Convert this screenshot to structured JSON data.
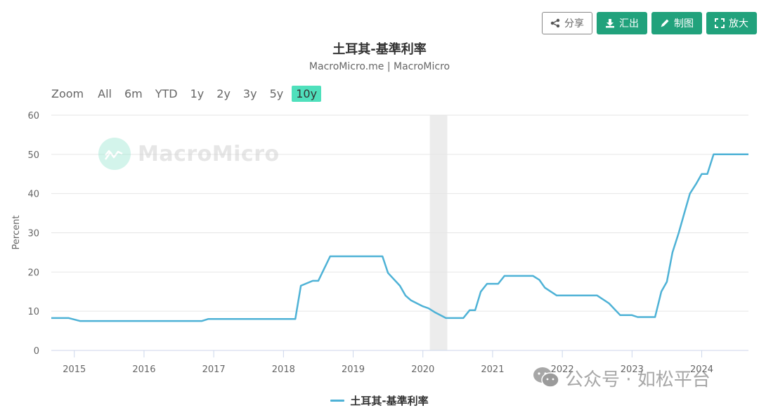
{
  "toolbar": {
    "share_label": "分享",
    "export_label": "汇出",
    "draw_label": "制图",
    "expand_label": "放大"
  },
  "header": {
    "title": "土耳其-基準利率",
    "subtitle": "MacroMicro.me | MacroMicro"
  },
  "range_selector": {
    "zoom_label": "Zoom",
    "buttons": [
      "All",
      "6m",
      "YTD",
      "1y",
      "2y",
      "3y",
      "5y",
      "10y"
    ],
    "active": "10y"
  },
  "watermarks": {
    "brand": "MacroMicro",
    "wechat": "公众号 · 如松平台"
  },
  "colors": {
    "series": "#4eb2d6",
    "primary_button": "#21a27c",
    "active_range": "#4fe0bc",
    "recession_band": "#ececec"
  },
  "chart_data": {
    "type": "line",
    "title": "土耳其-基準利率",
    "subtitle": "MacroMicro.me | MacroMicro",
    "xlabel": "",
    "ylabel": "Percent",
    "ylim": [
      0,
      60
    ],
    "yticks": [
      0,
      10,
      20,
      30,
      40,
      50,
      60
    ],
    "xlim": [
      2014.67,
      2024.67
    ],
    "xticks": [
      2015,
      2016,
      2017,
      2018,
      2019,
      2020,
      2021,
      2022,
      2023,
      2024
    ],
    "grid": true,
    "legend": "bottom-center",
    "shaded_regions": [
      {
        "from": 2020.1,
        "to": 2020.35,
        "label": "recession"
      }
    ],
    "series": [
      {
        "name": "土耳其-基準利率",
        "x": [
          2014.67,
          2014.92,
          2015.08,
          2016.83,
          2016.92,
          2018.17,
          2018.25,
          2018.42,
          2018.5,
          2018.67,
          2019.42,
          2019.5,
          2019.67,
          2019.75,
          2019.83,
          2020.0,
          2020.08,
          2020.17,
          2020.33,
          2020.58,
          2020.67,
          2020.75,
          2020.83,
          2020.92,
          2021.08,
          2021.17,
          2021.58,
          2021.67,
          2021.75,
          2021.92,
          2022.5,
          2022.67,
          2022.83,
          2023.0,
          2023.08,
          2023.33,
          2023.42,
          2023.5,
          2023.58,
          2023.67,
          2023.75,
          2023.83,
          2023.92,
          2024.0,
          2024.08,
          2024.17,
          2024.67
        ],
        "values": [
          8.25,
          8.25,
          7.5,
          7.5,
          8.0,
          8.0,
          16.5,
          17.75,
          17.75,
          24.0,
          24.0,
          19.75,
          16.5,
          14.0,
          12.75,
          11.25,
          10.75,
          9.75,
          8.25,
          8.25,
          10.25,
          10.25,
          15.0,
          17.0,
          17.0,
          19.0,
          19.0,
          18.0,
          16.0,
          14.0,
          14.0,
          12.0,
          9.0,
          9.0,
          8.5,
          8.5,
          15.0,
          17.5,
          25.0,
          30.0,
          35.0,
          40.0,
          42.5,
          45.0,
          45.0,
          50.0,
          50.0
        ]
      }
    ]
  }
}
